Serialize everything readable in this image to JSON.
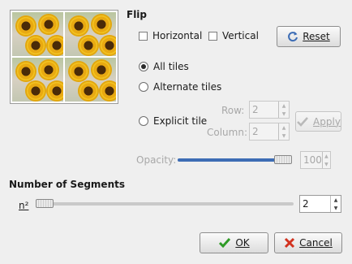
{
  "flip": {
    "heading": "Flip",
    "horizontal_label": "Horizontal",
    "vertical_label": "Vertical",
    "reset_label": "Reset"
  },
  "tiles": {
    "all_label": "All tiles",
    "alternate_label": "Alternate tiles",
    "explicit_label": "Explicit tile",
    "selected": "All tiles",
    "row_label": "Row:",
    "row_value": "2",
    "column_label": "Column:",
    "column_value": "2",
    "apply_label": "Apply"
  },
  "opacity": {
    "label": "Opacity:",
    "value": "100",
    "level": 1.0
  },
  "segments": {
    "heading": "Number of Segments",
    "n_label": "n²",
    "value": "2"
  },
  "actions": {
    "ok_label": "OK",
    "cancel_label": "Cancel"
  },
  "colors": {
    "accent": "#3d6db5",
    "ok_check": "#2f9b27",
    "cancel_x": "#d2321f"
  },
  "icons": [
    "reset-icon",
    "apply-check-icon",
    "ok-check-icon",
    "cancel-x-icon"
  ]
}
